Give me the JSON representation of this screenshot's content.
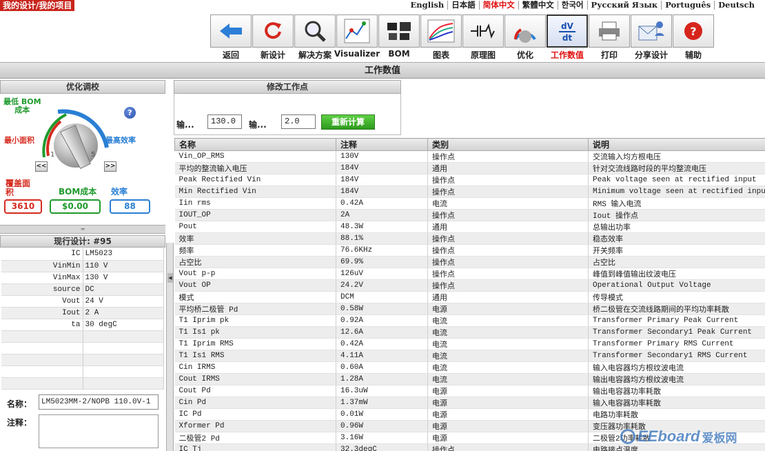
{
  "breadcrumb": "我的设计/我的项目",
  "languages": [
    {
      "label": "English",
      "active": false
    },
    {
      "label": "日本語",
      "active": false
    },
    {
      "label": "简体中文",
      "active": true
    },
    {
      "label": "繁體中文",
      "active": false
    },
    {
      "label": "한국어",
      "active": false
    },
    {
      "label": "Русский Язык",
      "active": false
    },
    {
      "label": "Português",
      "active": false
    },
    {
      "label": "Deutsch",
      "active": false
    }
  ],
  "toolbar": [
    {
      "label": "返回",
      "icon": "back-arrow-icon"
    },
    {
      "label": "新设计",
      "icon": "refresh-icon"
    },
    {
      "label": "解决方案",
      "icon": "magnifier-icon"
    },
    {
      "label": "Visualizer",
      "icon": "visualizer-icon"
    },
    {
      "label": "BOM",
      "icon": "chips-icon"
    },
    {
      "label": "图表",
      "icon": "chart-icon"
    },
    {
      "label": "原理图",
      "icon": "schematic-icon"
    },
    {
      "label": "优化",
      "icon": "knob-icon"
    },
    {
      "label": "工作数值",
      "icon": "dvdt-icon",
      "selected": true
    },
    {
      "label": "打印",
      "icon": "printer-icon"
    },
    {
      "label": "分享设计",
      "icon": "share-icon"
    },
    {
      "label": "辅助",
      "icon": "help-icon"
    }
  ],
  "page_title": "工作数值",
  "optimize": {
    "title": "优化调校",
    "label_low_bom": "最低 BOM\n成本",
    "label_min_area": "最小面积",
    "label_max_eff": "最高效率",
    "scale_min": "1",
    "scale_max": "5",
    "prev": "<<",
    "next": ">>",
    "help": "?",
    "metrics": [
      {
        "label": "覆盖面\n积",
        "value": "3610",
        "color": "#d62a1e"
      },
      {
        "label": "BOM成本",
        "value": "$0.00",
        "color": "#1e9a2c"
      },
      {
        "label": "效率",
        "value": "88",
        "color": "#2a7fd4"
      }
    ]
  },
  "current_design": {
    "title": "现行设计: #95",
    "rows": [
      {
        "k": "IC",
        "v": "LM5023"
      },
      {
        "k": "VinMin",
        "v": "110 V"
      },
      {
        "k": "VinMax",
        "v": "130 V"
      },
      {
        "k": "source",
        "v": "DC"
      },
      {
        "k": "Vout",
        "v": "24 V"
      },
      {
        "k": "Iout",
        "v": "2 A"
      },
      {
        "k": "ta",
        "v": "30 degC"
      },
      {
        "k": "",
        "v": ""
      },
      {
        "k": "",
        "v": ""
      },
      {
        "k": "",
        "v": ""
      },
      {
        "k": "",
        "v": ""
      },
      {
        "k": "",
        "v": ""
      }
    ],
    "name_label": "名称：",
    "name_value": "LM5023MM-2/NOPB 110.0V-1",
    "note_label": "注释："
  },
  "op_editor": {
    "title": "修改工作点",
    "label1": "输...",
    "value1": "130.0",
    "label2": "输...",
    "value2": "2.0",
    "recalc": "重新计算"
  },
  "table": {
    "headers": [
      "名称",
      "注释",
      "类别",
      "说明"
    ],
    "rows": [
      [
        "Vin_OP_RMS",
        "130V",
        "操作点",
        "交流输入均方根电压"
      ],
      [
        "平均的整流输入电压",
        "184V",
        "通用",
        "针对交流线路时段的平均整流电压"
      ],
      [
        "Peak Rectified Vin",
        "184V",
        "操作点",
        "Peak voltage seen at rectified input"
      ],
      [
        "Min Rectified Vin",
        "184V",
        "操作点",
        "Minimum voltage seen at rectified input"
      ],
      [
        "Iin rms",
        "0.42A",
        "电流",
        "RMS 输入电流"
      ],
      [
        "IOUT_OP",
        "2A",
        "操作点",
        "Iout 操作点"
      ],
      [
        "Pout",
        "48.3W",
        "通用",
        "总输出功率"
      ],
      [
        "效率",
        "88.1%",
        "操作点",
        "稳态效率"
      ],
      [
        "频率",
        "76.6KHz",
        "操作点",
        "开关频率"
      ],
      [
        "占空比",
        "69.9%",
        "操作点",
        "占空比"
      ],
      [
        "Vout p-p",
        "126uV",
        "操作点",
        "峰值到峰值输出纹波电压"
      ],
      [
        "Vout OP",
        "24.2V",
        "操作点",
        "Operational Output Voltage"
      ],
      [
        "模式",
        "DCM",
        "通用",
        "传导模式"
      ],
      [
        "平均桥二极管 Pd",
        "0.58W",
        "电源",
        "桥二极管在交流线路期间的平均功率耗散"
      ],
      [
        "T1 Iprim pk",
        "0.92A",
        "电流",
        "Transformer Primary Peak Current"
      ],
      [
        "T1 Is1 pk",
        "12.6A",
        "电流",
        "Transformer Secondary1 Peak Current"
      ],
      [
        "T1 Iprim RMS",
        "0.42A",
        "电流",
        "Transformer Primary RMS Current"
      ],
      [
        "T1 Is1 RMS",
        "4.11A",
        "电流",
        "Transformer Secondary1 RMS Current"
      ],
      [
        "Cin IRMS",
        "0.60A",
        "电流",
        "输入电容器均方根纹波电流"
      ],
      [
        "Cout IRMS",
        "1.28A",
        "电流",
        "输出电容器均方根纹波电流"
      ],
      [
        "Cout Pd",
        "16.3uW",
        "电源",
        "输出电容器功率耗散"
      ],
      [
        "Cin Pd",
        "1.37mW",
        "电源",
        "输入电容器功率耗散"
      ],
      [
        "IC Pd",
        "0.01W",
        "电源",
        "电路功率耗散"
      ],
      [
        "Xformer Pd",
        "0.96W",
        "电源",
        "变压器功率耗散"
      ],
      [
        "二极管2 Pd",
        "3.16W",
        "电源",
        "二极管2功率耗散"
      ],
      [
        "IC Tj",
        "32.3degC",
        "操作点",
        "电路接点温度"
      ]
    ]
  },
  "watermark": {
    "logo": "EEboard",
    "cn": "爱板网"
  }
}
